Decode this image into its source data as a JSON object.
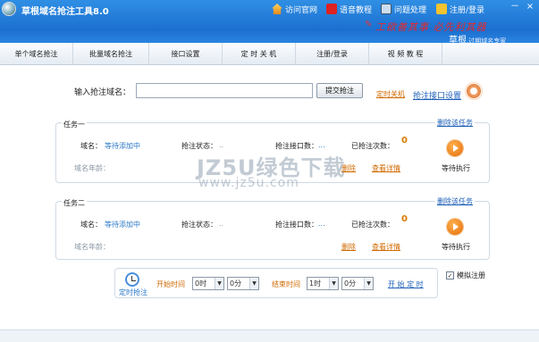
{
  "window": {
    "title": "草根域名抢注工具8.0",
    "nav": [
      "访问官网",
      "语音教程",
      "问题处理",
      "注册/登录"
    ],
    "slogan": "工欲善其事 必先利其器",
    "brand": "草根",
    "brand_sub": ".过期域名专家",
    "minimize": "－",
    "close": "×"
  },
  "menu": [
    "单个域名抢注",
    "批量域名抢注",
    "接口设置",
    "定 时 关 机",
    "注册/登录",
    "视 频 教 程"
  ],
  "input": {
    "label": "输入抢注域名：",
    "value": "",
    "submit": "提交抢注",
    "shutdown_link": "定时关机",
    "api_settings_link": "抢注接口设置"
  },
  "tasks": [
    {
      "title": "任务一",
      "delete": "删除该任务",
      "domain_label": "域名：",
      "domain_value": "等待添加中",
      "status_label": "抢注状态：",
      "status_value": "..",
      "api_label": "抢注接口数：",
      "api_value": "...",
      "count_label": "已抢注次数：",
      "count_value": "0",
      "age_label": "域名年龄：",
      "delete_short": "删除",
      "details": "查看详情",
      "state": "等待执行"
    },
    {
      "title": "任务二",
      "delete": "删除该任务",
      "domain_label": "域名：",
      "domain_value": "等待添加中",
      "status_label": "抢注状态：",
      "status_value": "..",
      "api_label": "抢注接口数：",
      "api_value": "...",
      "count_label": "已抢注次数：",
      "count_value": "0",
      "age_label": "域名年龄：",
      "delete_short": "删除",
      "details": "查看详情",
      "state": "等待执行"
    }
  ],
  "timer": {
    "label": "定时抢注",
    "start_label": "开始时间",
    "start_hour": "0时",
    "start_min": "0分",
    "end_label": "结束时间",
    "end_hour": "1时",
    "end_min": "0分",
    "start_button": "开 始 定 时",
    "simulate_label": "模拟注册",
    "simulate_checked": true
  },
  "watermark": {
    "line1": "JZ5U绿色下载",
    "line2": "www.jz5u.com"
  }
}
